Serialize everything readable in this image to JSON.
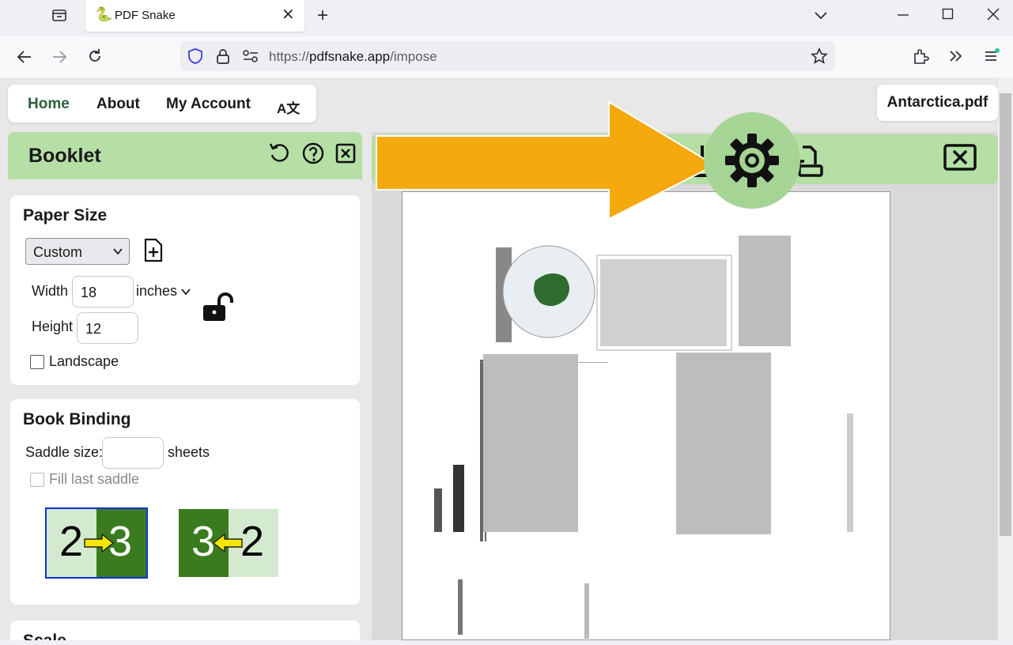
{
  "browser": {
    "tab_title": "PDF Snake",
    "url_prefix": "https://",
    "url_host": "pdfsnake.app",
    "url_path": "/impose",
    "icons": [
      "tab-list-icon",
      "snake-favicon-icon",
      "close-icon",
      "new-tab-icon",
      "chevron-down-icon",
      "minimize-icon",
      "maximize-icon",
      "window-close-icon",
      "back-icon",
      "forward-icon",
      "reload-icon",
      "shield-icon",
      "lock-icon",
      "permissions-icon",
      "bookmark-star-icon",
      "extensions-icon",
      "overflow-icon",
      "menu-icon"
    ]
  },
  "nav": {
    "home": "Home",
    "about": "About",
    "account": "My Account",
    "language": "A文",
    "filename": "Antarctica.pdf"
  },
  "sidebar": {
    "title": "Booklet",
    "paper_size": {
      "heading": "Paper Size",
      "preset": "Custom",
      "width_label": "Width",
      "width_value": "18",
      "units": "inches",
      "height_label": "Height",
      "height_value": "12",
      "landscape_label": "Landscape"
    },
    "book_binding": {
      "heading": "Book Binding",
      "saddle_label": "Saddle size:",
      "saddle_value": "",
      "saddle_unit": "sheets",
      "fill_last_label": "Fill last saddle",
      "ltr": {
        "left": "2",
        "right": "3"
      },
      "rtl": {
        "left": "3",
        "right": "2"
      }
    },
    "scale_heading": "Scale"
  },
  "colors": {
    "accent_green": "#b5dfa5",
    "dark_green": "#3a7b1f",
    "light_green": "#d4ead0",
    "arrow_orange": "#f5a90c",
    "selected_border": "#1030d8"
  }
}
